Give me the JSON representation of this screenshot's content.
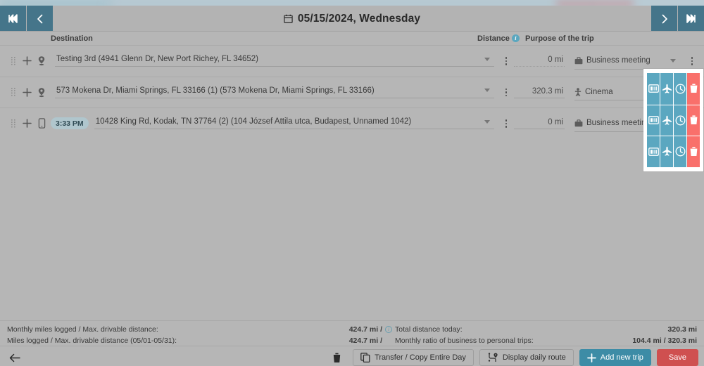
{
  "header": {
    "first_label": "⏮",
    "prev_label": "‹",
    "next_label": "›",
    "last_label": "⏭",
    "title": "05/15/2024, Wednesday",
    "calendar_icon": "calendar-icon"
  },
  "columns": {
    "destination": "Destination",
    "distance": "Distance",
    "distance_info": "i",
    "purpose": "Purpose of the trip"
  },
  "rows": [
    {
      "marker_icon": "location-pin-icon",
      "time": "",
      "destination": "Testing 3rd (4941 Glenn Dr, New Port Richey, FL 34652)",
      "distance": "0 mi",
      "distance_style": "dotted",
      "purpose_icon": "briefcase-icon",
      "purpose": "Business meeting"
    },
    {
      "marker_icon": "location-pin-icon",
      "time": "",
      "destination": "573 Mokena Dr, Miami Springs, FL 33166 (1) (573 Mokena Dr, Miami Springs, FL 33166)",
      "distance": "320.3 mi",
      "distance_style": "solid",
      "purpose_icon": "person-icon",
      "purpose": "Cinema"
    },
    {
      "marker_icon": "phone-icon",
      "time": "3:33 PM",
      "destination": "10428 King Rd, Kodak, TN 37764 (2) (104 József Attila utca, Budapest, Unnamed 1042)",
      "distance": "0 mi",
      "distance_style": "solid",
      "purpose_icon": "briefcase-icon",
      "purpose": "Business meeting"
    }
  ],
  "actions": [
    {
      "receipt": "receipt-card-icon",
      "flight": "airplane-icon",
      "clock": "clock-icon",
      "delete": "trash-icon"
    },
    {
      "receipt": "receipt-card-icon",
      "flight": "airplane-icon",
      "clock": "clock-icon",
      "delete": "trash-icon"
    },
    {
      "receipt": "receipt-card-icon",
      "flight": "airplane-icon",
      "clock": "clock-icon",
      "delete": "trash-icon"
    }
  ],
  "summary": {
    "line1_label": "Monthly miles logged / Max. drivable distance:",
    "line1_value": "424.7 mi /",
    "line1_info": "i",
    "line2_label": "Miles logged / Max. drivable distance (05/01-05/31):",
    "line2_value": "424.7 mi /",
    "right1_label": "Total distance today:",
    "right1_value": "320.3 mi",
    "right2_label": "Monthly ratio of business to personal trips:",
    "right2_value": "104.4 mi / 320.3 mi"
  },
  "toolbar": {
    "back_icon": "back-arrow-icon",
    "trash_icon": "trash-icon",
    "transfer_label": "Transfer / Copy Entire Day",
    "transfer_icon": "copy-icon",
    "route_label": "Display daily route",
    "route_icon": "route-icon",
    "add_trip_label": "Add new trip",
    "add_trip_icon": "plus-icon",
    "save_label": "Save"
  },
  "colors": {
    "teal": "#45758a",
    "action_blue": "#5ba7c0",
    "action_red": "#f9706b",
    "primary_button": "#3d8ca6",
    "save_button": "#cf5050",
    "time_chip": "#b0c6cd",
    "surface": "#b6b6b6"
  }
}
